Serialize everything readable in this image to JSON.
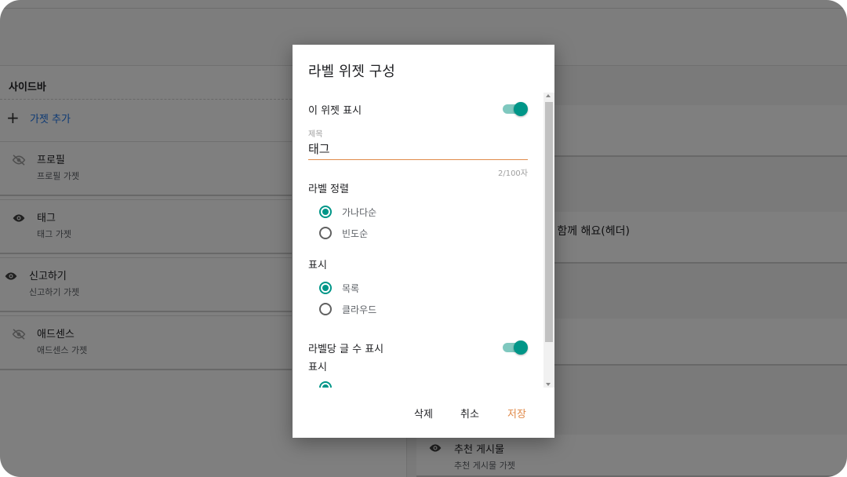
{
  "sidebar": {
    "title": "사이드바",
    "add_label": "가젯 추가",
    "gadgets": [
      {
        "title": "프로필",
        "subtitle": "프로필 가젯",
        "visible": false
      },
      {
        "title": "태그",
        "subtitle": "태그 가젯",
        "visible": true
      },
      {
        "title": "신고하기",
        "subtitle": "신고하기 가젯",
        "visible": true
      },
      {
        "title": "애드센스",
        "subtitle": "애드센스 가젯",
        "visible": false
      }
    ]
  },
  "right": {
    "partial_item": "부 함께 해요(헤더)",
    "recommended": {
      "title": "추천 게시물",
      "subtitle": "추천 게시물 가젯"
    }
  },
  "dialog": {
    "title": "라벨 위젯 구성",
    "show_widget_label": "이 위젯 표시",
    "show_widget_on": true,
    "title_field_caption": "제목",
    "title_field_value": "태그",
    "title_field_counter": "2/100자",
    "sort_heading": "라벨 정렬",
    "sort_options": [
      {
        "label": "가나다순",
        "checked": true
      },
      {
        "label": "빈도순",
        "checked": false
      }
    ],
    "display_heading": "표시",
    "display_options": [
      {
        "label": "목록",
        "checked": true
      },
      {
        "label": "클라우드",
        "checked": false
      }
    ],
    "show_count_label": "라벨당 글 수 표시",
    "show_count_on": true,
    "display_heading_2": "표시",
    "buttons": {
      "delete": "삭제",
      "cancel": "취소",
      "save": "저장"
    }
  },
  "colors": {
    "accent": "#009688",
    "save": "#e08a4a",
    "link": "#1a73e8"
  }
}
